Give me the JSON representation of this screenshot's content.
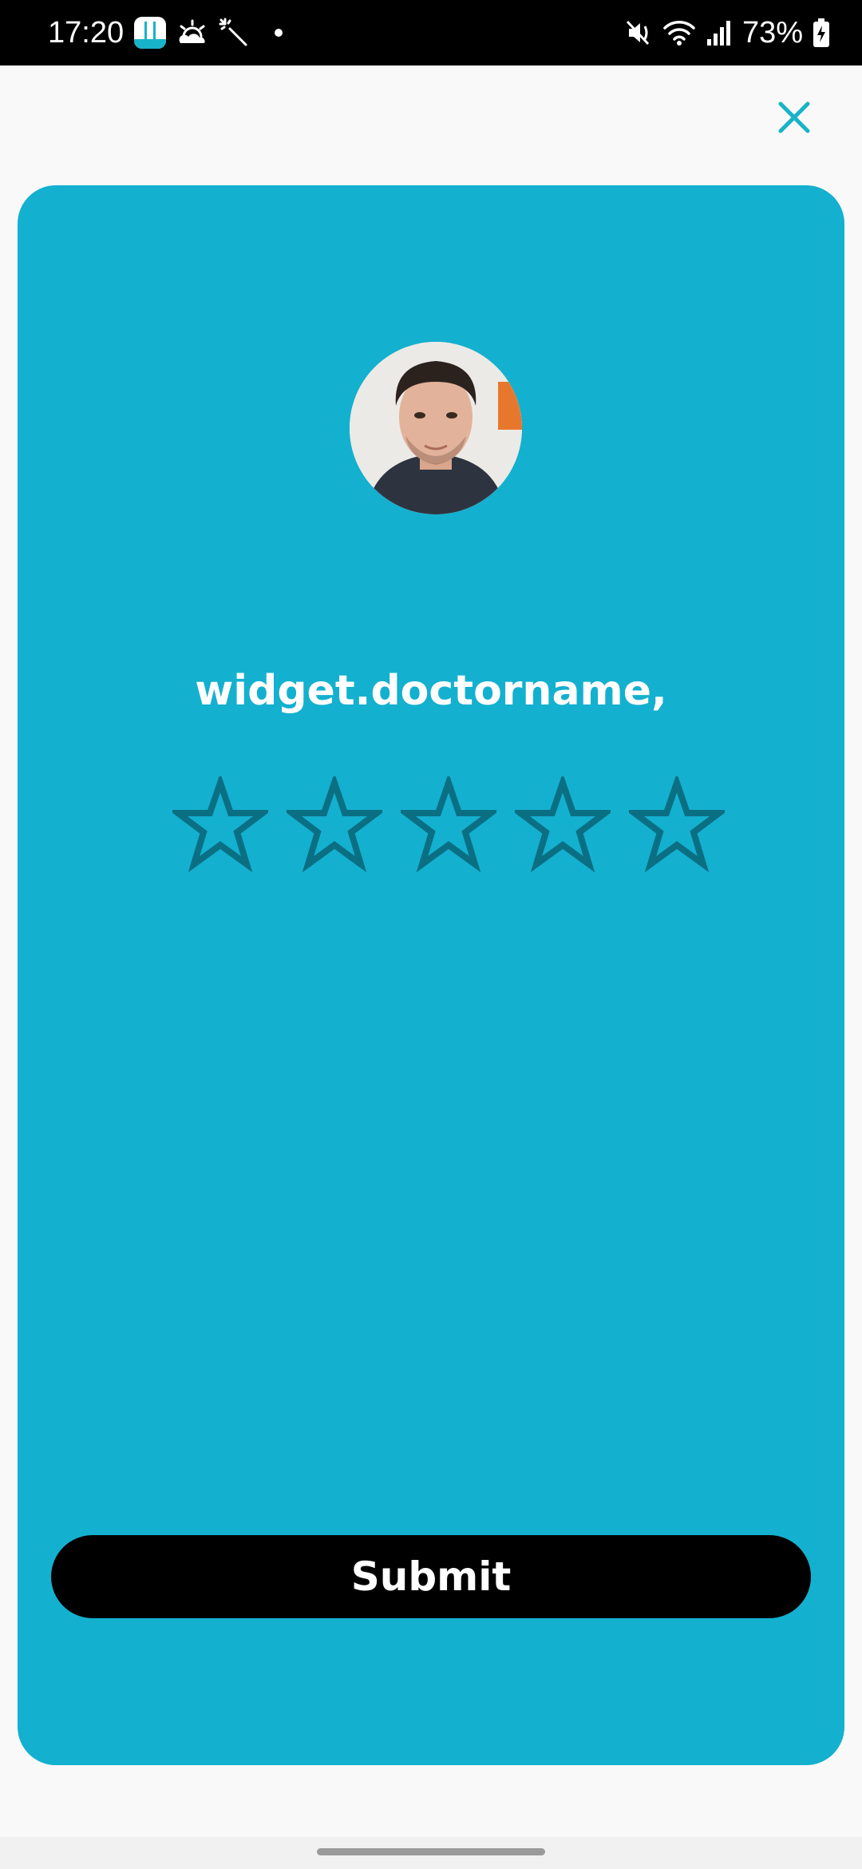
{
  "status_bar": {
    "time": "17:20",
    "battery": "73%",
    "left_icons": [
      "app-notification-icon",
      "weather-sunrise-icon",
      "magic-wand-icon",
      "more-dot-icon"
    ],
    "right_icons": [
      "mute-icon",
      "wifi-icon",
      "signal-icon",
      "battery-charging-icon"
    ]
  },
  "header": {
    "close_icon": "close-icon",
    "accent_color": "#17b3c9"
  },
  "card": {
    "background": "#14b0cf",
    "doctor_name": "widget.doctorname,",
    "rating": {
      "value": 0,
      "max": 5,
      "star_outline_color": "#0b6f84"
    },
    "submit_label": "Submit"
  }
}
